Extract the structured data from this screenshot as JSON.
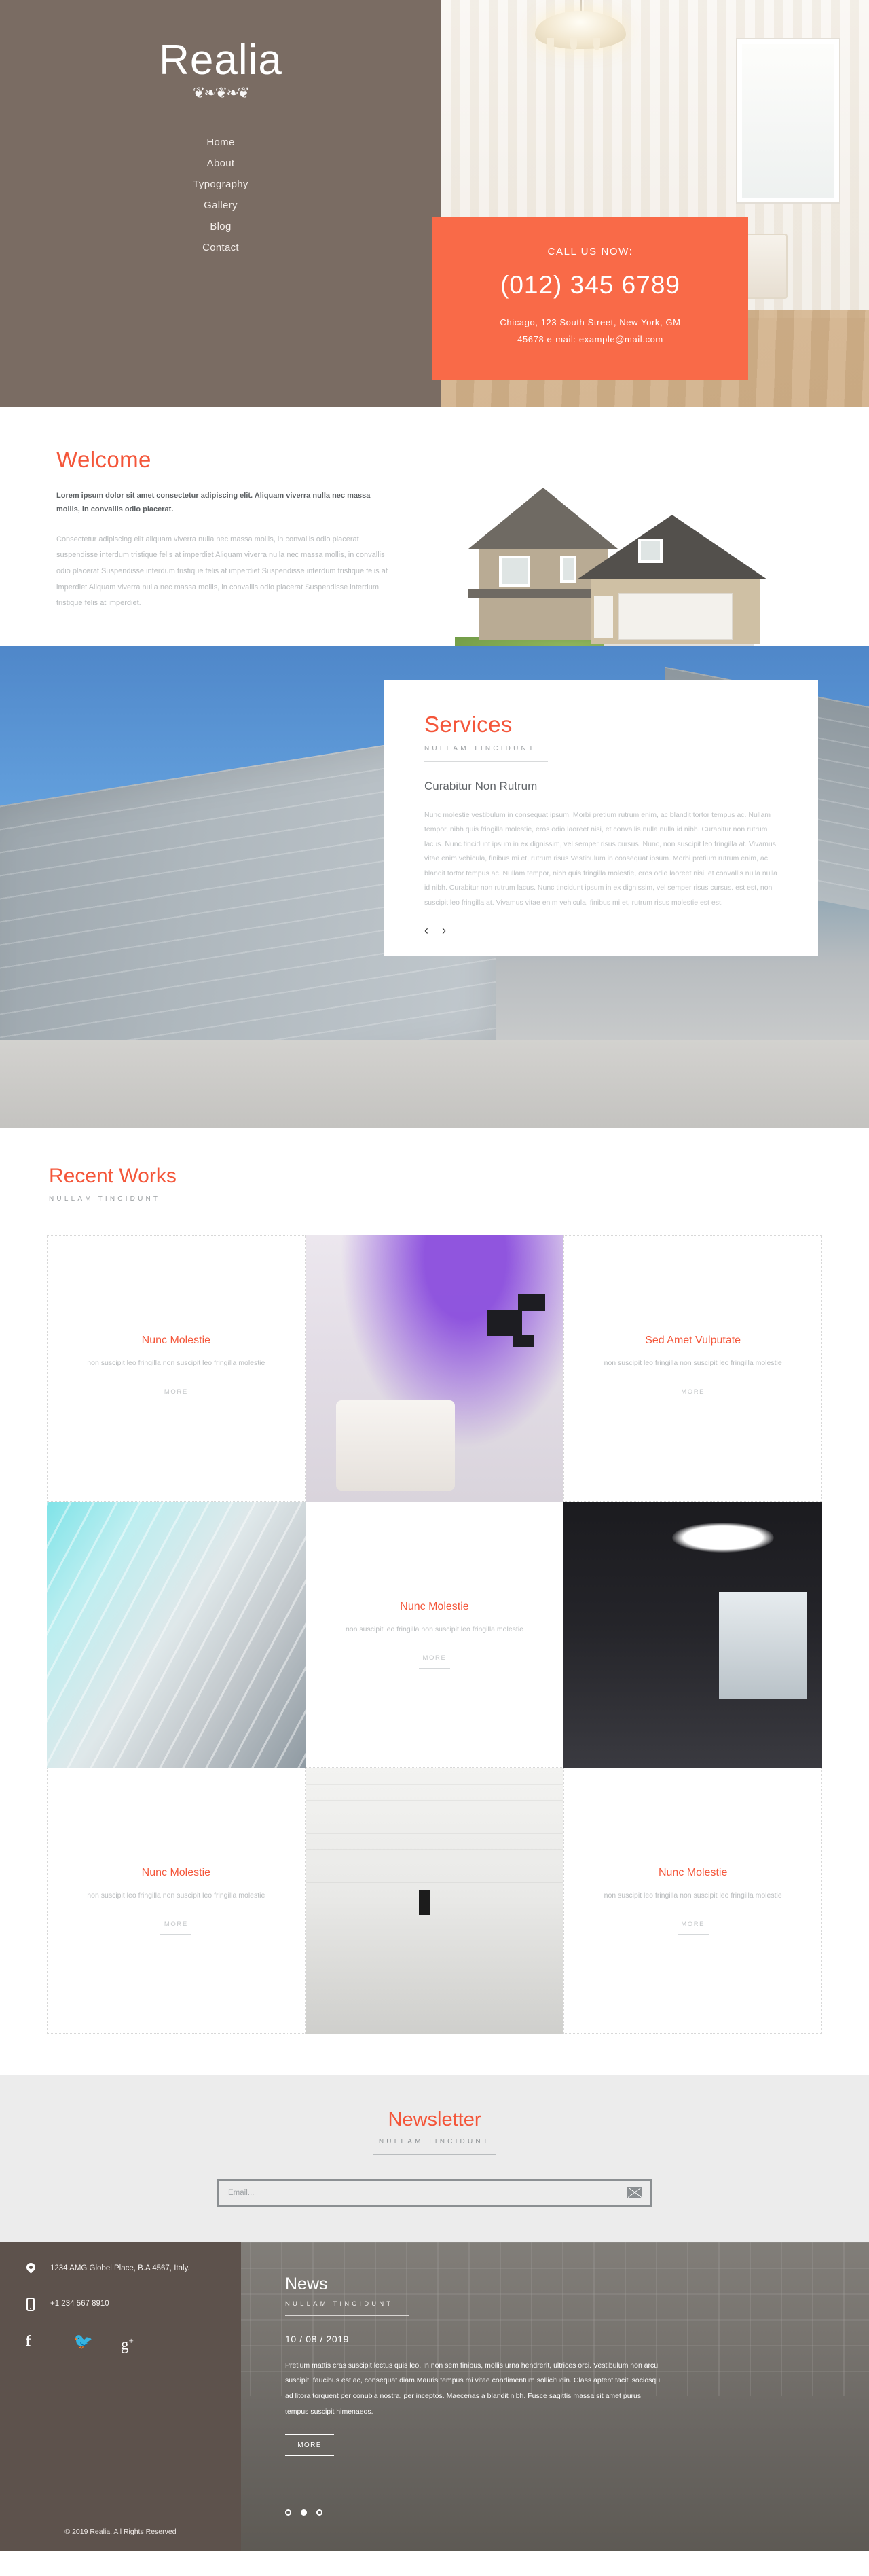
{
  "brand": {
    "name": "Realia",
    "ornament": "❦❦❦"
  },
  "nav": {
    "items": [
      "Home",
      "About",
      "Typography",
      "Gallery",
      "Blog",
      "Contact"
    ]
  },
  "cta": {
    "kicker": "CALL US NOW:",
    "phone": "(012) 345 6789",
    "address_line1": "Chicago, 123 South Street, New York, GM",
    "address_line2": "45678 e-mail: example@mail.com",
    "color": "#f96a48"
  },
  "welcome": {
    "title": "Welcome",
    "lead": "Lorem ipsum dolor sit amet consectetur adipiscing elit. Aliquam viverra nulla nec massa mollis, in convallis odio placerat.",
    "body": "Consectetur adipiscing elit aliquam viverra nulla nec massa mollis, in convallis odio placerat suspendisse interdum tristique felis at imperdiet Aliquam viverra nulla nec massa mollis, in convallis odio placerat Suspendisse interdum tristique felis at imperdiet Suspendisse interdum tristique felis at imperdiet Aliquam viverra nulla nec massa mollis, in convallis odio placerat Suspendisse interdum tristique felis at imperdiet."
  },
  "services": {
    "title": "Services",
    "subtitle": "NULLAM TINCIDUNT",
    "heading": "Curabitur Non Rutrum",
    "body": "Nunc molestie vestibulum in consequat ipsum. Morbi pretium rutrum enim, ac blandit tortor tempus ac. Nullam tempor, nibh quis fringilla molestie, eros odio laoreet nisi, et convallis nulla nulla id nibh. Curabitur non rutrum lacus. Nunc tincidunt ipsum in ex dignissim, vel semper risus cursus. Nunc, non suscipit leo fringilla at. Vivamus vitae enim vehicula, finibus mi et, rutrum risus Vestibulum in consequat ipsum. Morbi pretium rutrum enim, ac blandit tortor tempus ac. Nullam tempor, nibh quis fringilla molestie, eros odio laoreet nisi, et convallis nulla nulla id nibh. Curabitur non rutrum lacus. Nunc tincidunt ipsum in ex dignissim, vel semper risus cursus. est est, non suscipit leo fringilla at. Vivamus vitae enim vehicula, finibus mi et, rutrum risus molestie est est.",
    "prev_icon": "‹",
    "next_icon": "›"
  },
  "works": {
    "title": "Recent Works",
    "subtitle": "NULLAM TINCIDUNT",
    "more_label": "MORE",
    "items": [
      {
        "title": "Nunc Molestie",
        "desc": "non suscipit leo fringilla non suscipit leo fringilla molestie"
      },
      {
        "title": "Sed Amet Vulputate",
        "desc": "non suscipit leo fringilla non suscipit leo fringilla molestie"
      },
      {
        "title": "Nunc Molestie",
        "desc": "non suscipit leo fringilla non suscipit leo fringilla molestie"
      },
      {
        "title": "Nunc Molestie",
        "desc": "non suscipit leo fringilla non suscipit leo fringilla molestie"
      },
      {
        "title": "Nunc Molestie",
        "desc": "non suscipit leo fringilla non suscipit leo fringilla molestie"
      }
    ]
  },
  "newsletter": {
    "title": "Newsletter",
    "subtitle": "NULLAM TINCIDUNT",
    "placeholder": "Email...",
    "value": ""
  },
  "footer": {
    "address": "1234 AMG Globel Place, B.A 4567, Italy.",
    "phone": "+1 234 567 8910",
    "socials": [
      "facebook-icon",
      "twitter-icon",
      "google-plus-icon"
    ],
    "social_glyphs": [
      "f",
      "🐦",
      "g+"
    ],
    "copyright": "© 2019 Realia. All Rights Reserved",
    "news": {
      "title": "News",
      "subtitle": "NULLAM TINCIDUNT",
      "date": "10 / 08 / 2019",
      "body": "Pretium mattis cras suscipit lectus quis leo. In non sem finibus, mollis urna hendrerit, ultrices orci. Vestibulum non arcu suscipit, faucibus est ac, consequat diam.Mauris tempus mi vitae condimentum sollicitudin. Class aptent taciti sociosqu ad litora torquent per conubia nostra, per inceptos. Maecenas a blandit nibh. Fusce sagittis massa sit amet purus tempus suscipit himenaeos.",
      "more_label": "MORE"
    }
  },
  "colors": {
    "accent": "#f4563a",
    "cta": "#f96a48",
    "brown": "#7a6c63",
    "footer_brown": "#5d524c"
  }
}
